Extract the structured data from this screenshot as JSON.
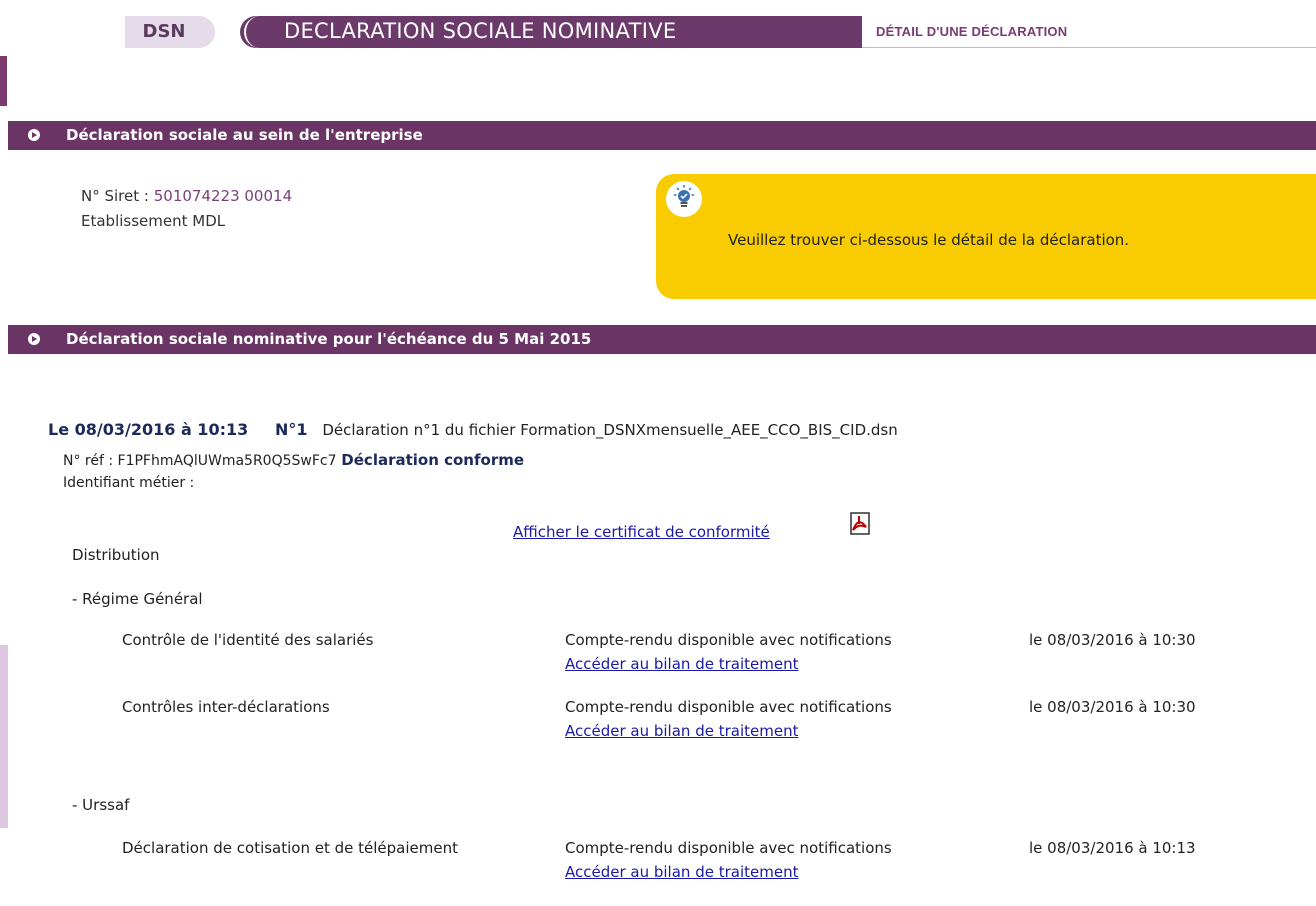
{
  "header": {
    "dsn_label": "DSN",
    "title": "DECLARATION SOCIALE NOMINATIVE",
    "subtitle": "DÉTAIL D'UNE DÉCLARATION"
  },
  "section1": {
    "title": "Déclaration sociale au sein de l'entreprise",
    "siret_label": "N° Siret :",
    "siret_value": "501074223 00014",
    "establishment": "Etablissement MDL",
    "info_message": "Veuillez trouver ci-dessous le détail de la déclaration."
  },
  "section2": {
    "title": "Déclaration sociale nominative pour l'échéance du 5 Mai 2015",
    "declaration": {
      "date": "Le 08/03/2016 à 10:13",
      "number": "N°1",
      "description": "Déclaration n°1 du fichier Formation_DSNXmensuelle_AEE_CCO_BIS_CID.dsn",
      "ref_label": "N° réf : F1PFhmAQlUWma5R0Q5SwFc7",
      "status": "Déclaration conforme",
      "business_id_label": "Identifiant métier :",
      "certificate_link": "Afficher le certificat de conformité"
    },
    "distribution_label": "Distribution",
    "groups": [
      {
        "name": "- Régime Général",
        "rows": [
          {
            "label": "Contrôle de l'identité des salariés",
            "status": "Compte-rendu disponible avec notifications",
            "link": "Accéder au bilan de traitement",
            "date": "le 08/03/2016 à 10:30"
          },
          {
            "label": "Contrôles inter-déclarations",
            "status": "Compte-rendu disponible avec notifications",
            "link": "Accéder au bilan de traitement",
            "date": "le 08/03/2016 à 10:30"
          }
        ]
      },
      {
        "name": "- Urssaf",
        "rows": [
          {
            "label": "Déclaration de cotisation et de télépaiement",
            "status": "Compte-rendu disponible avec notifications",
            "link": "Accéder au bilan de traitement",
            "date": "le 08/03/2016 à 10:13"
          }
        ]
      }
    ]
  },
  "colors": {
    "brand_purple": "#6a3565",
    "info_yellow": "#f8cc00",
    "link_blue": "#1a1aa6"
  }
}
